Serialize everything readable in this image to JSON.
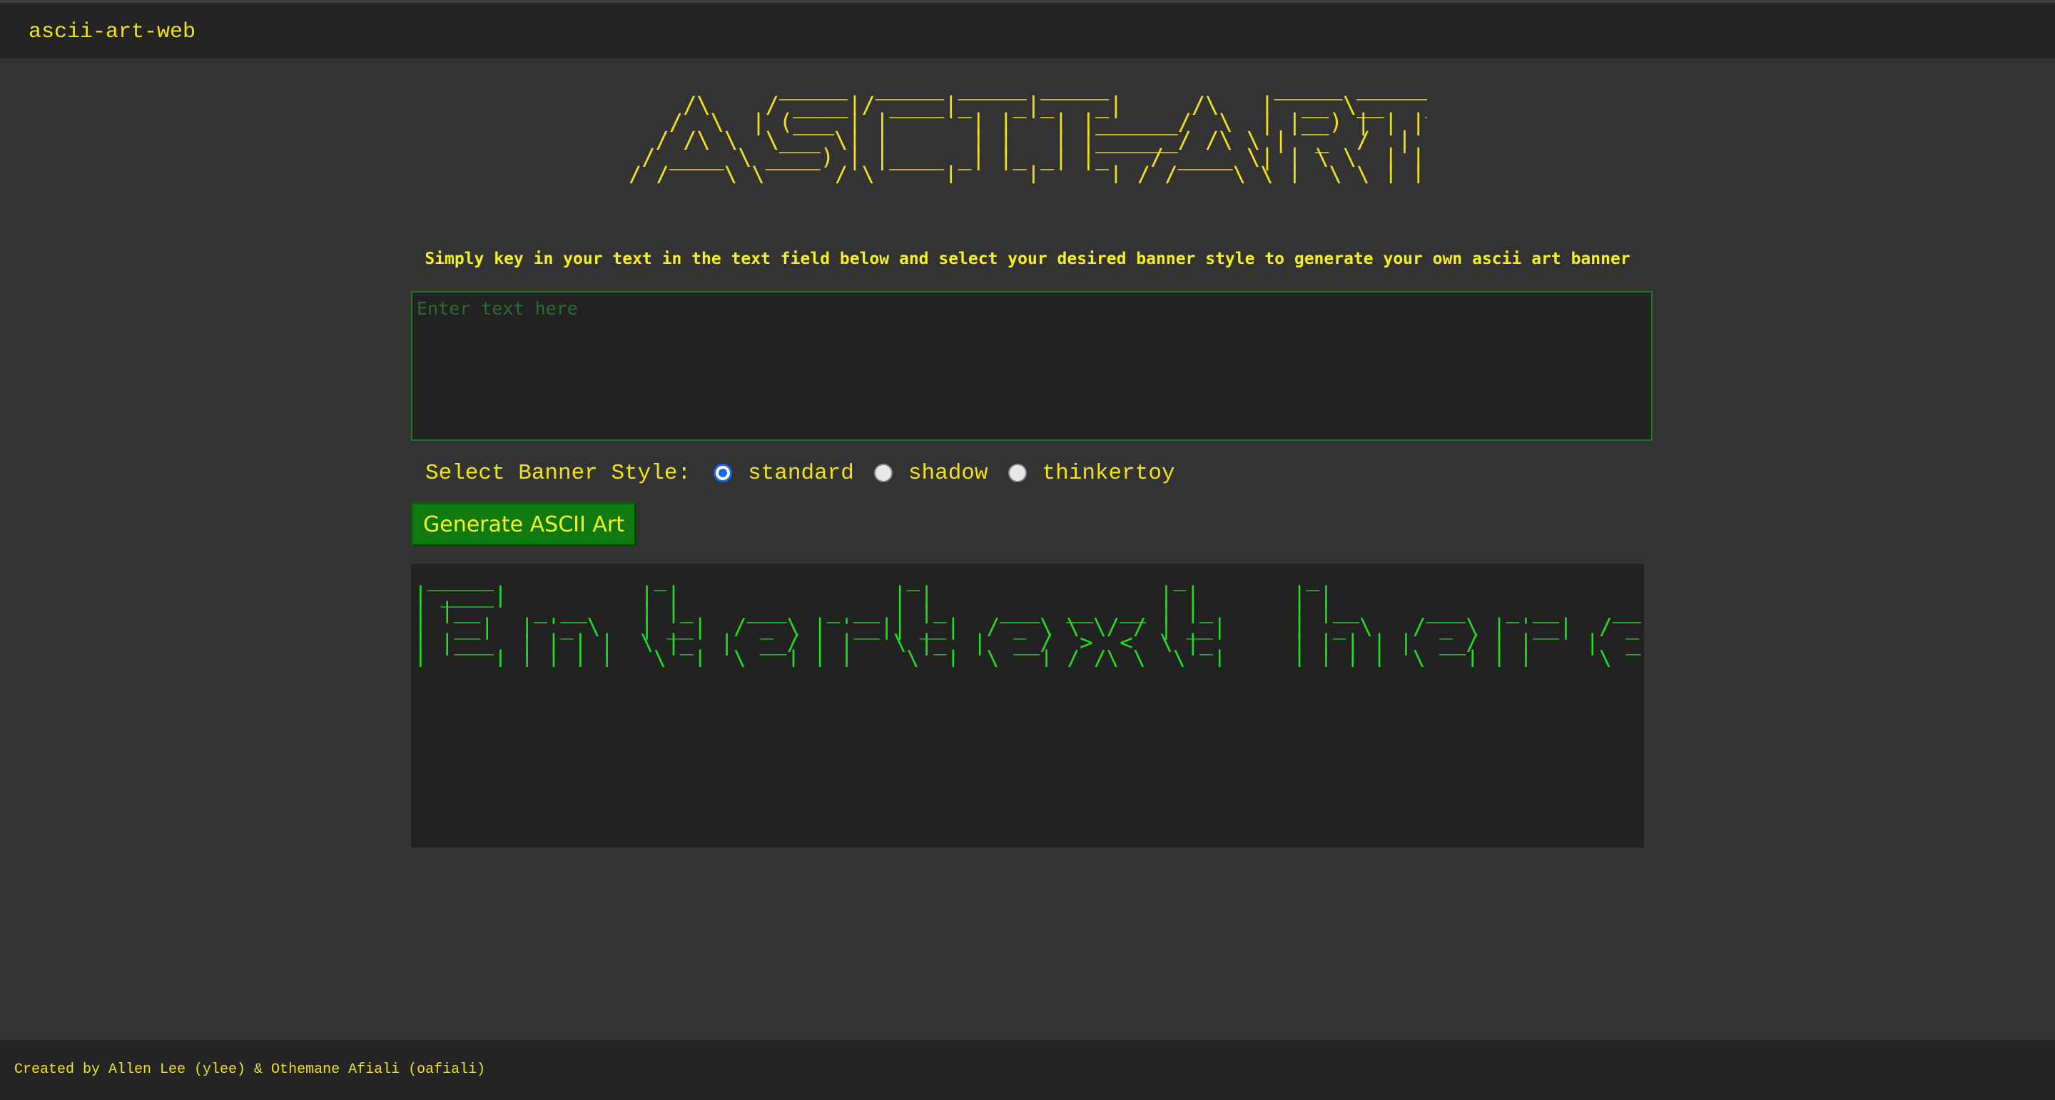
{
  "header": {
    "brand": "ascii-art-web"
  },
  "title_art": {
    "lines": [
      "           _____  _____ _____ _____            _____ _______",
      "    /\\    / ____|/ ____|_   _|_   _|     /\\   |  __ \\__   __|",
      "   /  \\  | (___ | |      | |   | |______/  \\  | |__) | | |",
      "  / /\\ \\  \\___ \\| |      | |   | |______/ /\\ \\ |  _  /  | |",
      " / ____ \\ ____) | |____ _| |_ _| |_   / ____ \\| | \\ \\  | |",
      "/_/    \\_\\_____/ \\_____|_____|_____| /_/    \\_\\_|  \\_\\ |_|"
    ]
  },
  "instructions": "Simply key in your text in the text field below and select your desired banner style to generate your own ascii art banner",
  "input": {
    "placeholder": "Enter text here",
    "value": ""
  },
  "banner_style": {
    "label": "Select Banner Style:",
    "options": [
      {
        "label": "standard",
        "checked": true
      },
      {
        "label": "shadow",
        "checked": false
      },
      {
        "label": "thinkertoy",
        "checked": false
      }
    ]
  },
  "generate_button": {
    "label": "Generate ASCII Art"
  },
  "output_art": {
    "lines": [
      " _____            _                  _                   _         _",
      "| ____|          | |                | |                 | |       | |",
      "| |__    _ __    | |_    ___   _ __ | |_    ___  __  __ | |_      | |__     ___   _ __    ___",
      "|  __|  | '_ \\   | __|  / _ \\ | '__|| __|  / _ \\ \\ \\/ / | __|     |  _ \\   / _ \\ | '__|  / _ \\",
      "| |___  | | | |  \\ |_  |  __/ | |   \\ |_  |  __/  >  <  \\ |_      | | | | |  __/ | |    |  __/",
      "|_____| |_| |_|   \\__|  \\___| |_|    \\__|  \\___| /_/\\_\\  \\__|     |_| |_|  \\___| |_|     \\___|"
    ]
  },
  "footer": {
    "credits": "Created by Allen Lee (ylee) & Othemane Afiali (oafiali)"
  }
}
